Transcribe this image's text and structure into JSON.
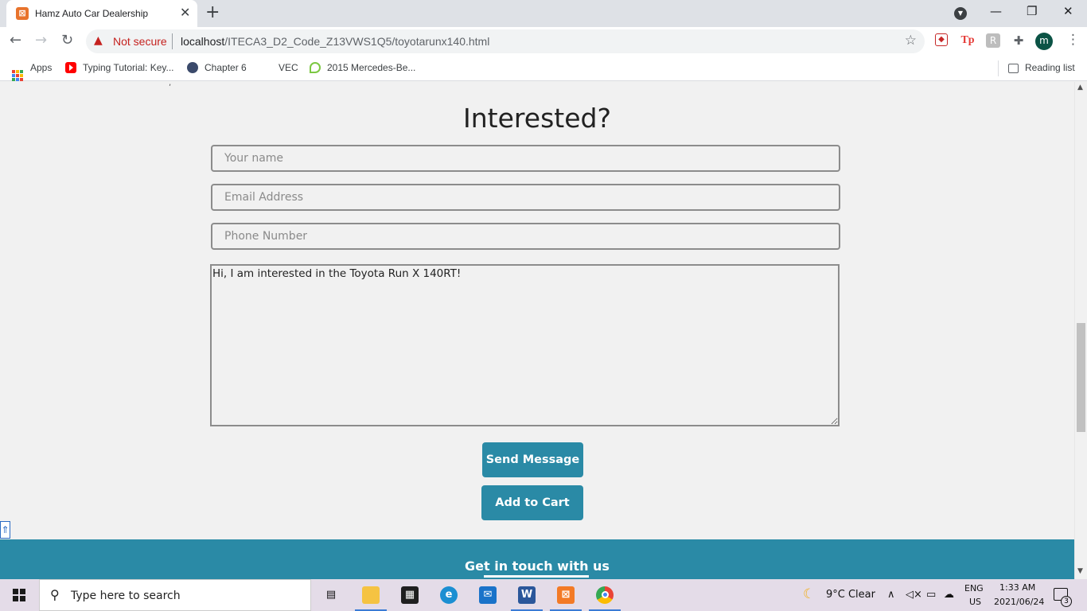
{
  "browser": {
    "tab_title": "Hamz Auto Car Dealership",
    "tab_close": "✕",
    "new_tab": "+",
    "security_label": "Not secure",
    "url_host": "localhost",
    "url_path": "/ITECA3_D2_Code_Z13VWS1Q5/toyotarunx140.html",
    "profile_initial": "m",
    "bookmarks": [
      {
        "label": "Apps"
      },
      {
        "label": "Typing Tutorial: Key..."
      },
      {
        "label": "Chapter 6"
      },
      {
        "label": "VEC"
      },
      {
        "label": "2015 Mercedes-Be..."
      }
    ],
    "reading_list": "Reading list"
  },
  "form": {
    "heading": "Interested?",
    "name_placeholder": "Your name",
    "email_placeholder": "Email Address",
    "phone_placeholder": "Phone Number",
    "message_value": "Hi, I am interested in the Toyota Run X 140RT!",
    "send_label": "Send Message",
    "cart_label": "Add to Cart"
  },
  "footer": {
    "title": "Get in touch with us"
  },
  "taskbar": {
    "search_placeholder": "Type here to search",
    "weather": "9°C  Clear",
    "lang_top": "ENG",
    "lang_bottom": "US",
    "time": "1:33 AM",
    "date": "2021/06/24",
    "notification_count": "3"
  }
}
